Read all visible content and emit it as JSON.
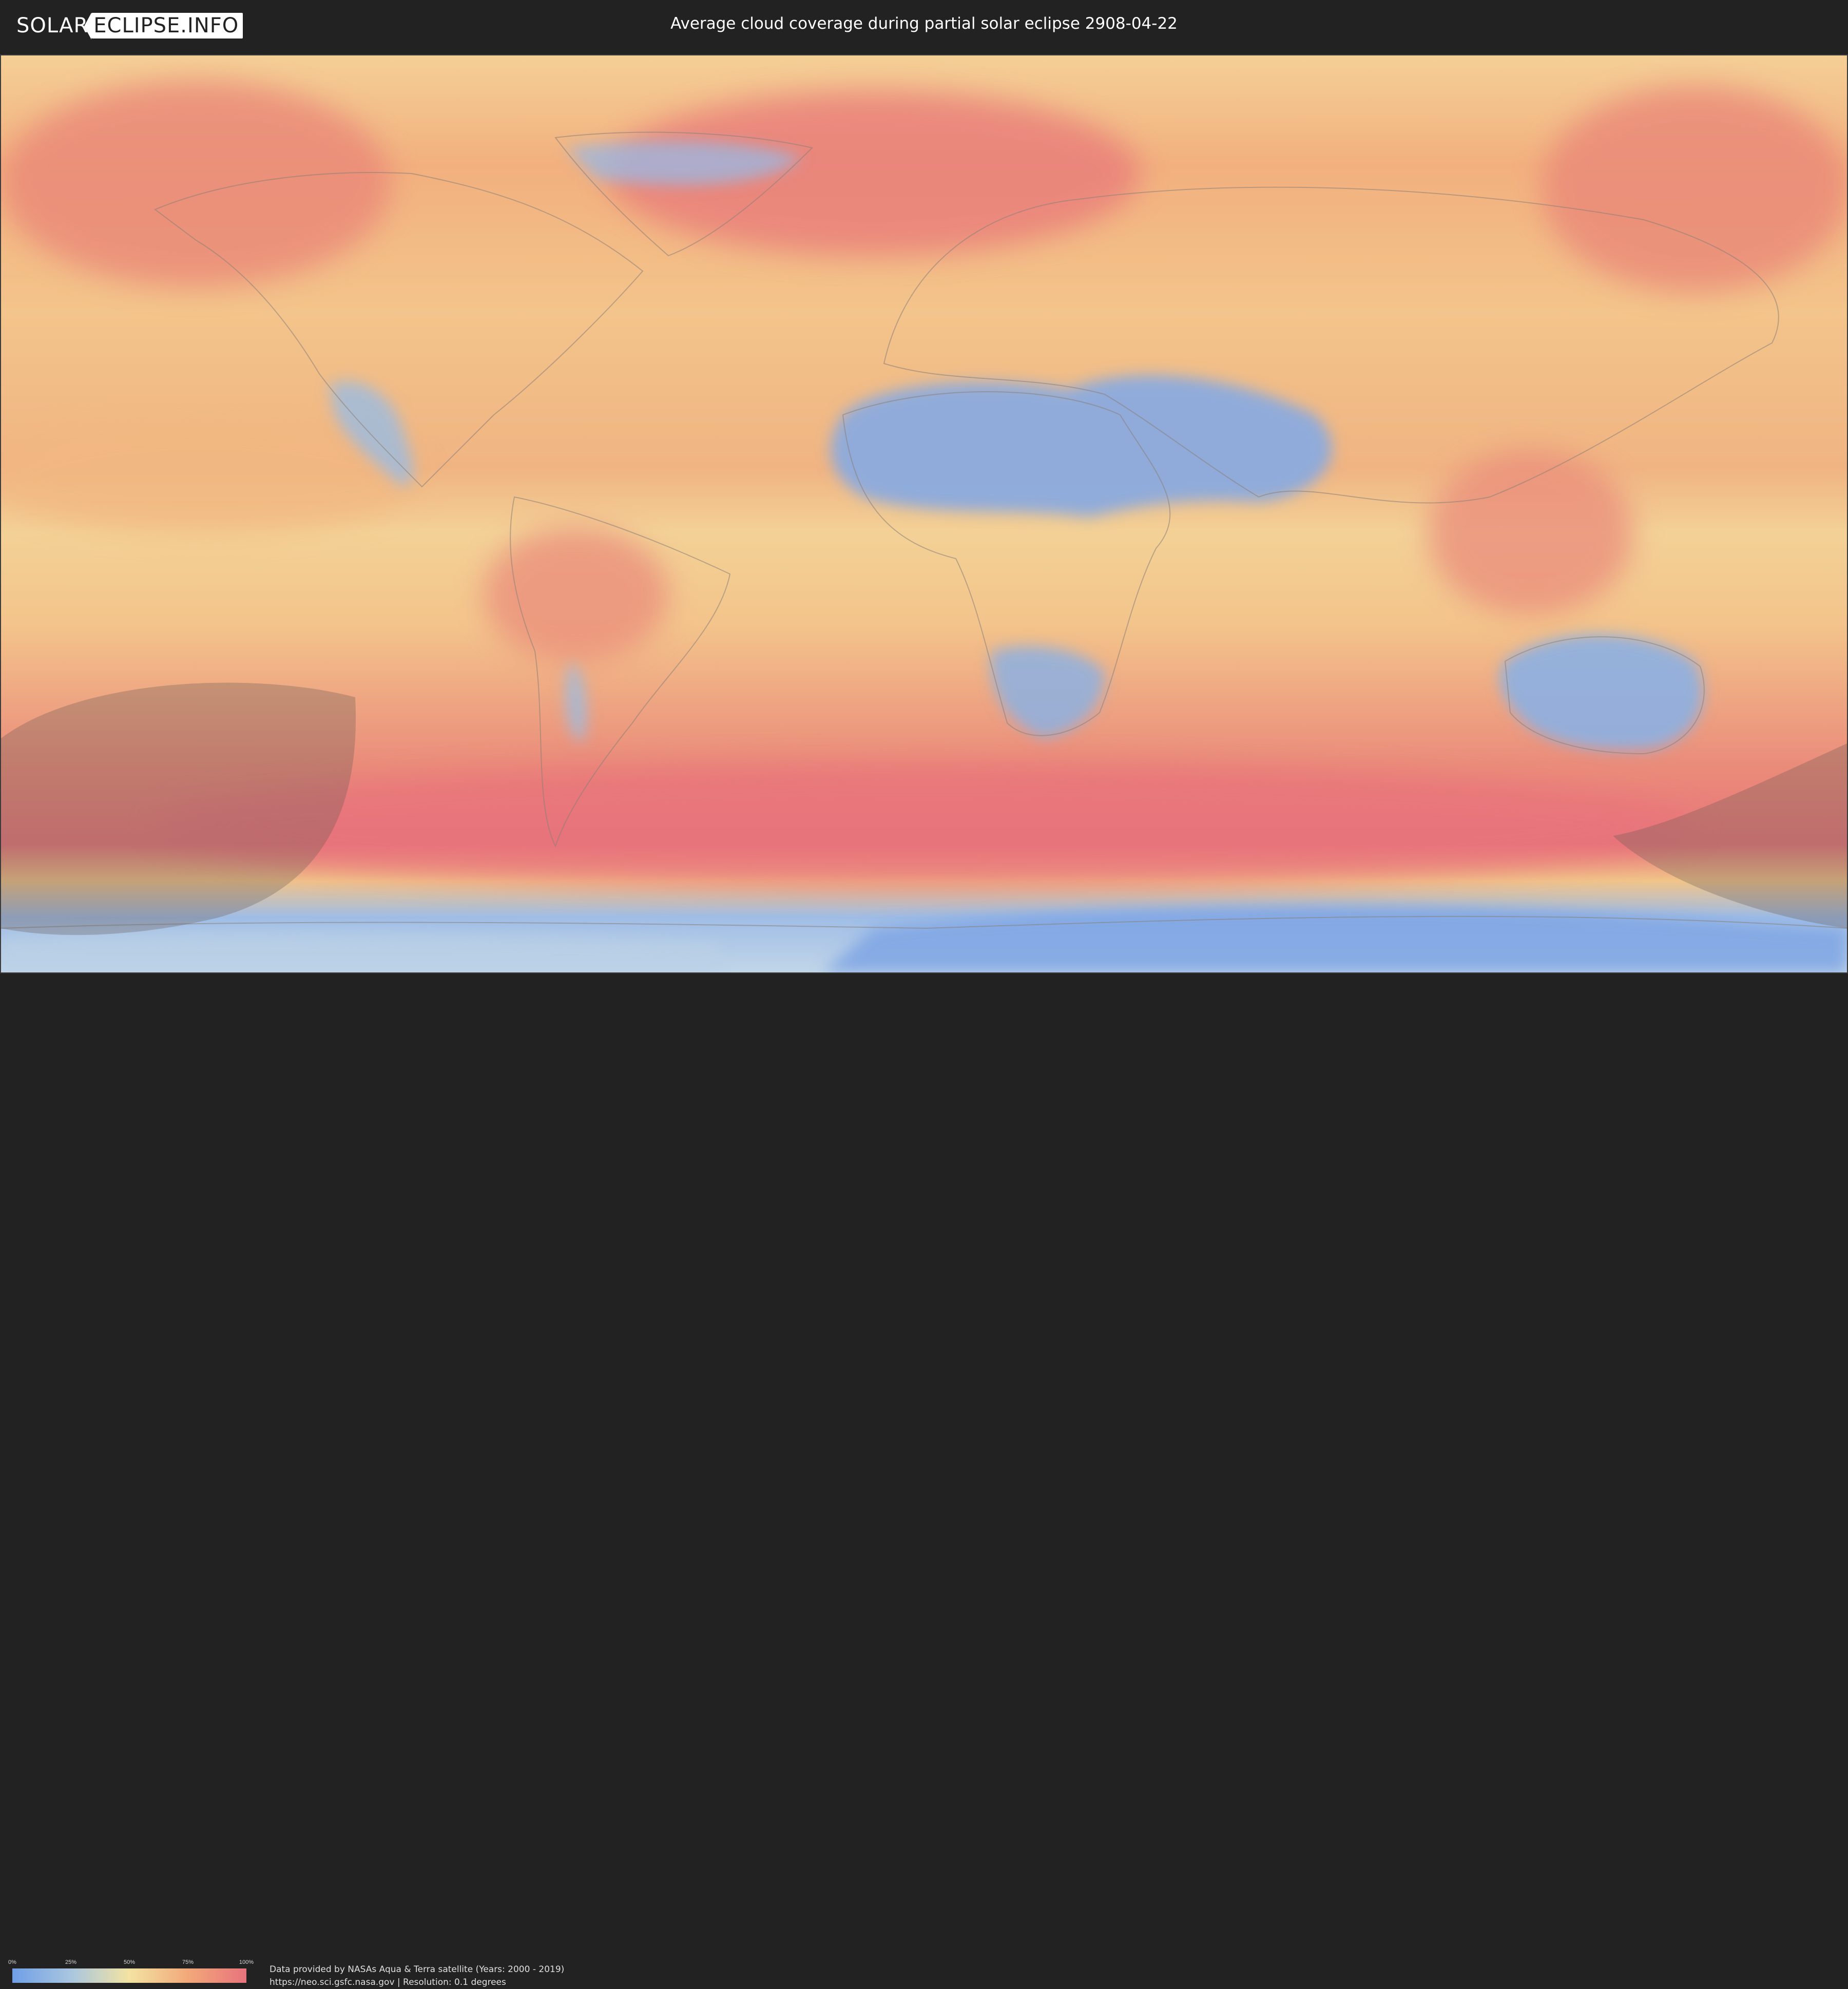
{
  "header": {
    "logo_left": "SOLAR",
    "logo_right": "ECLIPSE.INFO",
    "title": "Average cloud coverage during partial solar eclipse 2908-04-22"
  },
  "legend": {
    "ticks": [
      "0%",
      "25%",
      "50%",
      "75%",
      "100%"
    ],
    "colors": [
      "#6f9fe6",
      "#a9c6e0",
      "#f3e3a2",
      "#f2a97a",
      "#e8737c"
    ]
  },
  "credits": {
    "line1": "Data provided by NASAs Aqua & Terra satellite (Years: 2000 - 2019)",
    "line2": "https://neo.sci.gsfc.nasa.gov | Resolution: 0.1 degrees"
  },
  "map": {
    "projection": "equirectangular",
    "eclipse_shadow_color": "#6b5a55"
  }
}
